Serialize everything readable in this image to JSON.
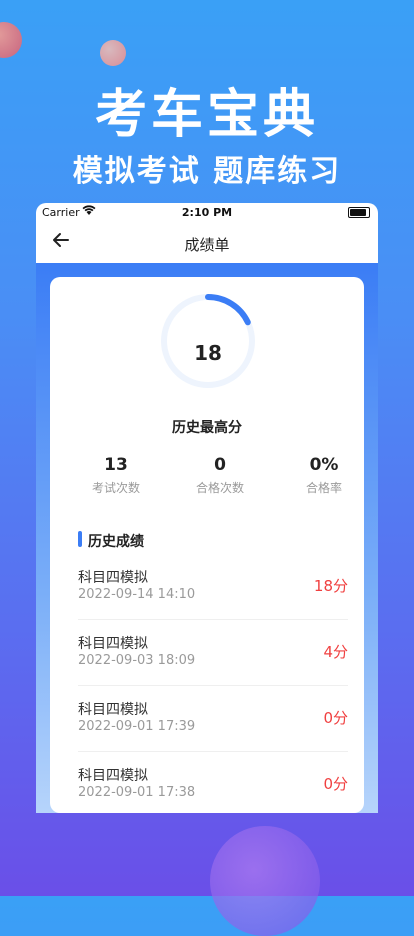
{
  "promo": {
    "title": "考车宝典",
    "subtitle": "模拟考试 题库练习"
  },
  "status_bar": {
    "carrier": "Carrier",
    "time": "2:10 PM"
  },
  "nav": {
    "title": "成绩单"
  },
  "summary": {
    "best_score": "18",
    "best_score_fraction": 0.18,
    "best_score_label": "历史最高分",
    "stats": [
      {
        "value": "13",
        "label": "考试次数"
      },
      {
        "value": "0",
        "label": "合格次数"
      },
      {
        "value": "0%",
        "label": "合格率"
      }
    ]
  },
  "history": {
    "title": "历史成绩",
    "records": [
      {
        "name": "科目四模拟",
        "date": "2022-09-14 14:10",
        "score": "18分"
      },
      {
        "name": "科目四模拟",
        "date": "2022-09-03 18:09",
        "score": "4分"
      },
      {
        "name": "科目四模拟",
        "date": "2022-09-01 17:39",
        "score": "0分"
      },
      {
        "name": "科目四模拟",
        "date": "2022-09-01 17:38",
        "score": "0分"
      }
    ]
  },
  "colors": {
    "accent": "#3b7df5",
    "score": "#f04040"
  }
}
